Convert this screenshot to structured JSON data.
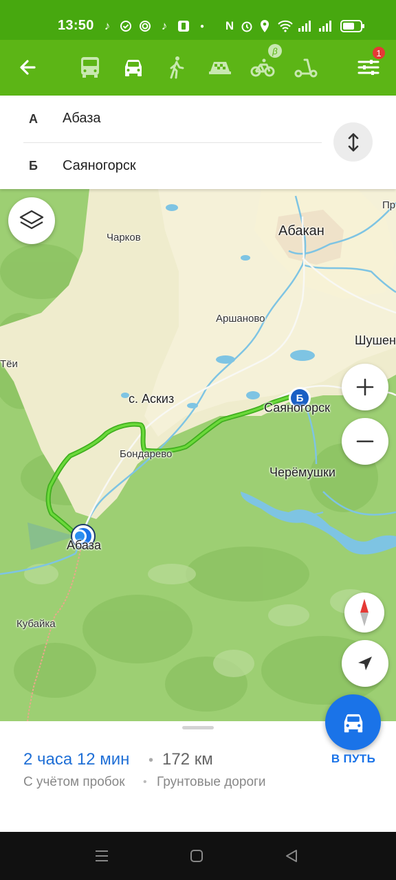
{
  "status_bar": {
    "time": "13:50",
    "icons": [
      "tiktok-icon",
      "check-circle-icon",
      "spiral-icon",
      "tiktok-icon",
      "battery-app-icon",
      "dot-icon",
      "nfc-icon",
      "alarm-icon",
      "location-icon",
      "wifi-icon",
      "signal-icon",
      "signal-icon",
      "battery-icon"
    ]
  },
  "transport": {
    "modes": [
      "bus",
      "car",
      "walk",
      "taxi",
      "bike",
      "scooter"
    ],
    "active": "car",
    "bike_badge": "β",
    "filter_badge": "1"
  },
  "route": {
    "point_a_letter": "А",
    "point_a": "Абаза",
    "point_b_letter": "Б",
    "point_b": "Саяногорск"
  },
  "map": {
    "labels": {
      "abakan": "Абакан",
      "pr": "Пр",
      "charkov": "Чарков",
      "arshanovo": "Аршаново",
      "shushen": "Шушен",
      "tei": "Тёи",
      "askiz": "с. Аскиз",
      "sayanogorsk": "Саяногорск",
      "bondarevo": "Бондарево",
      "cheremushki": "Черёмушки",
      "abaza": "Абаза",
      "kubaika": "Кубайка"
    },
    "marker_b": "Б",
    "route_color": "#4cc01e"
  },
  "summary": {
    "duration": "2 часа 12 мин",
    "separator": "•",
    "distance": "172 км",
    "note_traffic": "С учётом пробок",
    "note_roads": "Грунтовые дороги",
    "go_label": "В ПУТЬ"
  },
  "colors": {
    "status_bar": "#47a80f",
    "toolbar": "#5cb516",
    "accent_blue": "#1a73e8",
    "badge_red": "#e53935"
  }
}
